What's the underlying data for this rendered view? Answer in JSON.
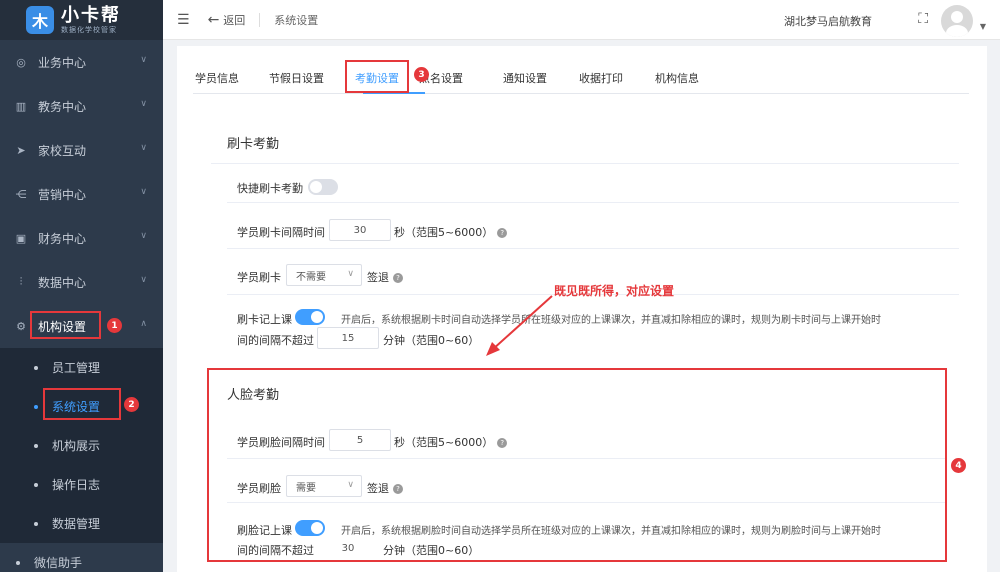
{
  "app": {
    "logo_title": "小卡帮",
    "logo_sub": "数据化学校管家",
    "logo_mark": "木"
  },
  "sidebar": {
    "items": [
      {
        "label": "业务中心",
        "icon": "globe-icon"
      },
      {
        "label": "教务中心",
        "icon": "book-icon"
      },
      {
        "label": "家校互动",
        "icon": "send-icon"
      },
      {
        "label": "营销中心",
        "icon": "share-icon"
      },
      {
        "label": "财务中心",
        "icon": "wallet-icon"
      },
      {
        "label": "数据中心",
        "icon": "chart-icon"
      },
      {
        "label": "机构设置",
        "icon": "gear-icon"
      }
    ],
    "sub_items": [
      "员工管理",
      "系统设置",
      "机构展示",
      "操作日志",
      "数据管理"
    ],
    "bottom_item": "微信助手"
  },
  "header": {
    "back_label": "返回",
    "breadcrumb": "系统设置",
    "org_name": "湖北梦马启航教育"
  },
  "tabs": [
    "学员信息",
    "节假日设置",
    "考勤设置",
    "点名设置",
    "通知设置",
    "收据打印",
    "机构信息"
  ],
  "card_section": {
    "title": "刷卡考勤",
    "quick_label": "快捷刷卡考勤",
    "interval_label": "学员刷卡间隔时间",
    "interval_value": "30",
    "interval_unit": "秒",
    "interval_range": "（范围5~6000）",
    "card_label": "学员刷卡",
    "card_select": "不需要",
    "card_suffix": "签退",
    "attend_label": "刷卡记上课",
    "attend_desc1": "开启后，系统根据刷卡时间自动选择学员所在班级对应的上课课次，并直减扣除相应的课时，规则为刷卡时间与上课开始时",
    "attend_desc2": "间的间隔不超过",
    "attend_value": "15",
    "attend_unit": "分钟",
    "attend_range": "（范围0~60）"
  },
  "face_section": {
    "title": "人脸考勤",
    "interval_label": "学员刷脸间隔时间",
    "interval_value": "5",
    "interval_unit": "秒",
    "interval_range": "（范围5~6000）",
    "face_label": "学员刷脸",
    "face_select": "需要",
    "face_suffix": "签退",
    "attend_label": "刷脸记上课",
    "attend_desc1": "开启后，系统根据刷脸时间自动选择学员所在班级对应的上课课次，并直减扣除相应的课时，规则为刷脸时间与上课开始时",
    "attend_desc2": "间的间隔不超过",
    "attend_value": "30",
    "attend_unit": "分钟",
    "attend_range": "（范围0~60）"
  },
  "annotations": {
    "text": "既见既所得，对应设置",
    "badges": [
      "1",
      "2",
      "3",
      "4"
    ],
    "color": "#e5383b"
  },
  "colors": {
    "sidebar_bg": "#2d3a4b",
    "accent": "#409eff"
  }
}
